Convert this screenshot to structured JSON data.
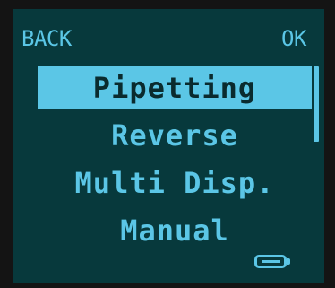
{
  "softkeys": {
    "left": "BACK",
    "right": "OK"
  },
  "menu": {
    "items": [
      {
        "label": "Pipetting",
        "selected": true
      },
      {
        "label": "Reverse",
        "selected": false
      },
      {
        "label": "Multi Disp.",
        "selected": false
      },
      {
        "label": "Manual",
        "selected": false
      }
    ]
  },
  "scroll": {
    "visible_fraction": 0.4,
    "position": 0.0
  },
  "battery": {
    "level": 0.8,
    "icon": "battery-icon"
  },
  "colors": {
    "screen_background": "#07393c",
    "foreground": "#5bc6e6",
    "selected_text": "#0a2b2e",
    "bezel": "#141414"
  }
}
